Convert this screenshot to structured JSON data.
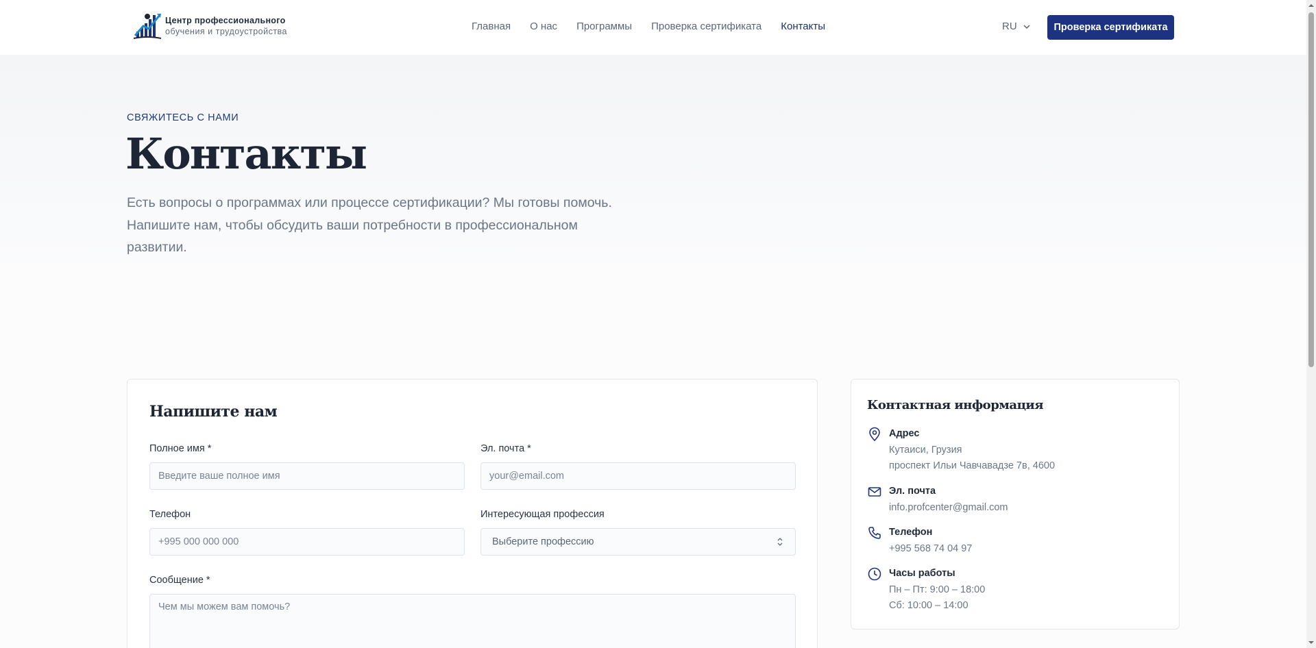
{
  "header": {
    "logo_line1": "Центр профессионального",
    "logo_line2": "обучения и трудоустройства",
    "nav": [
      "Главная",
      "О нас",
      "Программы",
      "Проверка сертификата",
      "Контакты"
    ],
    "active_nav": "Контакты",
    "lang": "RU",
    "cta_label": "Проверка сертификата"
  },
  "hero": {
    "eyebrow": "СВЯЖИТЕСЬ С НАМИ",
    "title": "Контакты",
    "lead": "Есть вопросы о программах или процессе сертификации? Мы готовы помочь. Напишите нам, чтобы обсудить ваши потребности в профессиональном развитии."
  },
  "form": {
    "title": "Напишите нам",
    "name_label": "Полное имя *",
    "name_placeholder": "Введите ваше полное имя",
    "email_label": "Эл. почта *",
    "email_placeholder": "your@email.com",
    "phone_label": "Телефон",
    "phone_placeholder": "+995 000 000 000",
    "profession_label": "Интересующая профессия",
    "profession_value": "Выберите профессию",
    "message_label": "Сообщение *",
    "message_placeholder": "Чем мы можем вам помочь?"
  },
  "contact_info": {
    "title": "Контактная информация",
    "address": {
      "icon": "map-pin-icon",
      "label": "Адрес",
      "lines": [
        "Кутаиси, Грузия",
        "проспект Ильи Чавчавадзе 7в, 4600"
      ]
    },
    "email": {
      "icon": "mail-icon",
      "label": "Эл. почта",
      "lines": [
        "info.profcenter@gmail.com"
      ]
    },
    "phone": {
      "icon": "phone-icon",
      "label": "Телефон",
      "lines": [
        "+995 568 74 04 97"
      ]
    },
    "hours": {
      "icon": "clock-icon",
      "label": "Часы работы",
      "lines": [
        "Пн – Пт: 9:00 – 18:00",
        "Сб: 10:00 – 14:00"
      ]
    }
  },
  "colors": {
    "brand": "#1d3382",
    "nav_active": "#1d3270",
    "text_muted": "#6b7686"
  }
}
